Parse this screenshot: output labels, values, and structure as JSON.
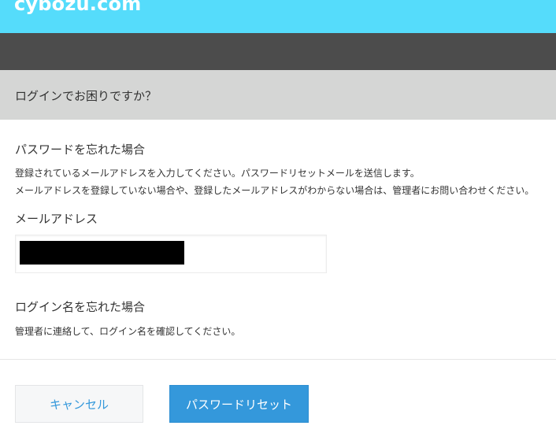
{
  "header": {
    "logo_text": "cybozu.com",
    "page_title": "ログインでお困りですか？"
  },
  "forgot_password": {
    "heading": "パスワードを忘れた場合",
    "desc_line1": "登録されているメールアドレスを入力してください。パスワードリセットメールを送信します。",
    "desc_line2": "メールアドレスを登録していない場合や、登録したメールアドレスがわからない場合は、管理者にお問い合わせください。",
    "email_label": "メールアドレス",
    "email_value": ""
  },
  "forgot_login": {
    "heading": "ログイン名を忘れた場合",
    "desc": "管理者に連絡して、ログイン名を確認してください。"
  },
  "buttons": {
    "cancel_label": "キャンセル",
    "reset_label": "パスワードリセット"
  },
  "colors": {
    "top_bar": "#55dcfb",
    "dark_bar": "#4c4c4c",
    "title_bar": "#d5d6d5",
    "accent": "#3498db"
  }
}
